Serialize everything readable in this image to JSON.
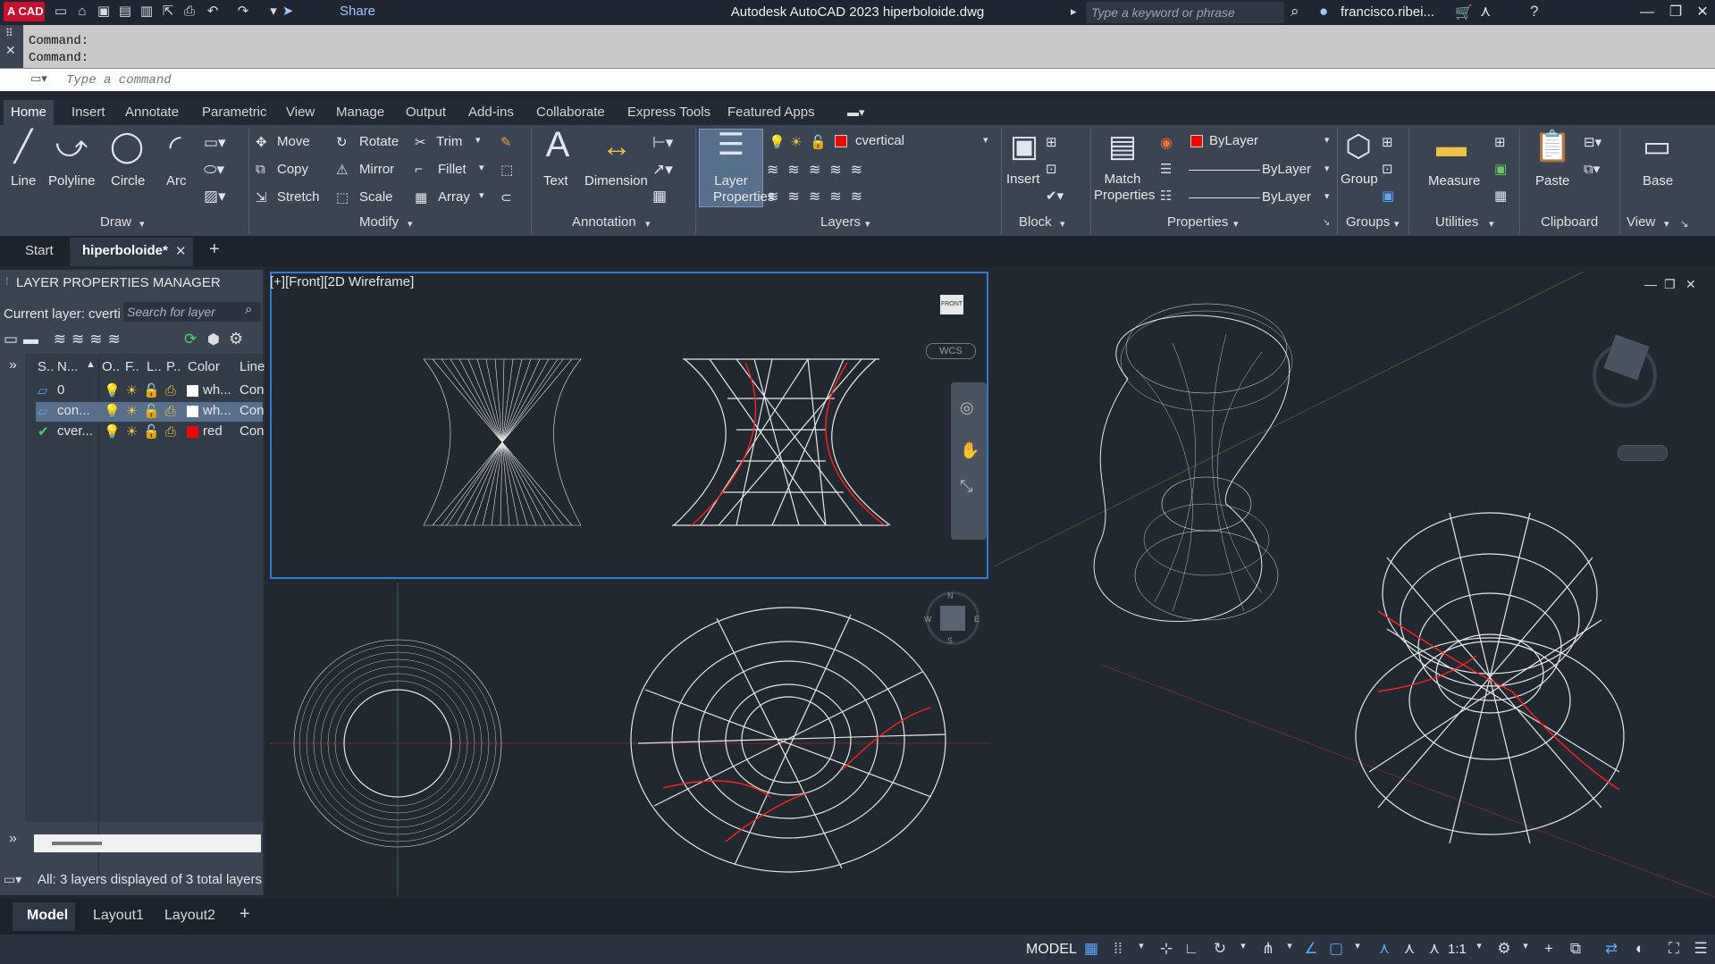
{
  "titlebar": {
    "logo": "A CAD",
    "share": "Share",
    "window_title": "Autodesk AutoCAD 2023    hiperboloide.dwg",
    "search_placeholder": "Type a keyword or phrase",
    "user": "francisco.ribei..."
  },
  "command": {
    "history": [
      "Command:",
      "Command:"
    ],
    "placeholder": "Type a command"
  },
  "ribbon_tabs": [
    "Home",
    "Insert",
    "Annotate",
    "Parametric",
    "View",
    "Manage",
    "Output",
    "Add-ins",
    "Collaborate",
    "Express Tools",
    "Featured Apps"
  ],
  "ribbon": {
    "draw": {
      "line": "Line",
      "polyline": "Polyline",
      "circle": "Circle",
      "arc": "Arc",
      "title": "Draw"
    },
    "modify": {
      "move": "Move",
      "rotate": "Rotate",
      "trim": "Trim",
      "copy": "Copy",
      "mirror": "Mirror",
      "fillet": "Fillet",
      "stretch": "Stretch",
      "scale": "Scale",
      "array": "Array",
      "title": "Modify"
    },
    "annotation": {
      "text": "Text",
      "dimension": "Dimension",
      "title": "Annotation"
    },
    "layers": {
      "layer_properties": "Layer Properties",
      "current": "cvertical",
      "title": "Layers"
    },
    "block": {
      "insert": "Insert",
      "title": "Block"
    },
    "properties": {
      "match": "Match Properties",
      "color": "ByLayer",
      "linetype": "ByLayer",
      "lineweight": "ByLayer",
      "title": "Properties"
    },
    "groups": {
      "group": "Group",
      "title": "Groups"
    },
    "utilities": {
      "measure": "Measure",
      "title": "Utilities"
    },
    "clipboard": {
      "paste": "Paste",
      "title": "Clipboard"
    },
    "view": {
      "base": "Base",
      "title": "View"
    }
  },
  "file_tabs": {
    "start": "Start",
    "active": "hiperboloide*"
  },
  "layer_manager": {
    "title": "LAYER PROPERTIES MANAGER",
    "current_layer": "Current layer: cverti",
    "search_placeholder": "Search for layer",
    "headers": [
      "S..",
      "N...",
      "O..",
      "F..",
      "L..",
      "P..",
      "Color",
      "Line"
    ],
    "rows": [
      {
        "name": "0",
        "color_name": "wh...",
        "color": "#ffffff",
        "linetype": "Con"
      },
      {
        "name": "con...",
        "color_name": "wh...",
        "color": "#ffffff",
        "linetype": "Con"
      },
      {
        "name": "cver...",
        "color_name": "red",
        "color": "#ff0000",
        "linetype": "Con"
      }
    ],
    "status": "All: 3 layers displayed of 3 total layers"
  },
  "viewports": {
    "front_label": "[+][Front][2D Wireframe]",
    "wcs": "WCS",
    "front_cube": "FRONT",
    "compass": {
      "n": "N",
      "s": "S",
      "e": "E",
      "w": "W"
    }
  },
  "layout_tabs": [
    "Model",
    "Layout1",
    "Layout2"
  ],
  "status": {
    "model": "MODEL",
    "scale": "1:1"
  },
  "colors": {
    "accent": "#2f7bd6",
    "red": "#ff0000",
    "ribbon_bg": "#3a4453",
    "drawing_bg": "#212830"
  }
}
